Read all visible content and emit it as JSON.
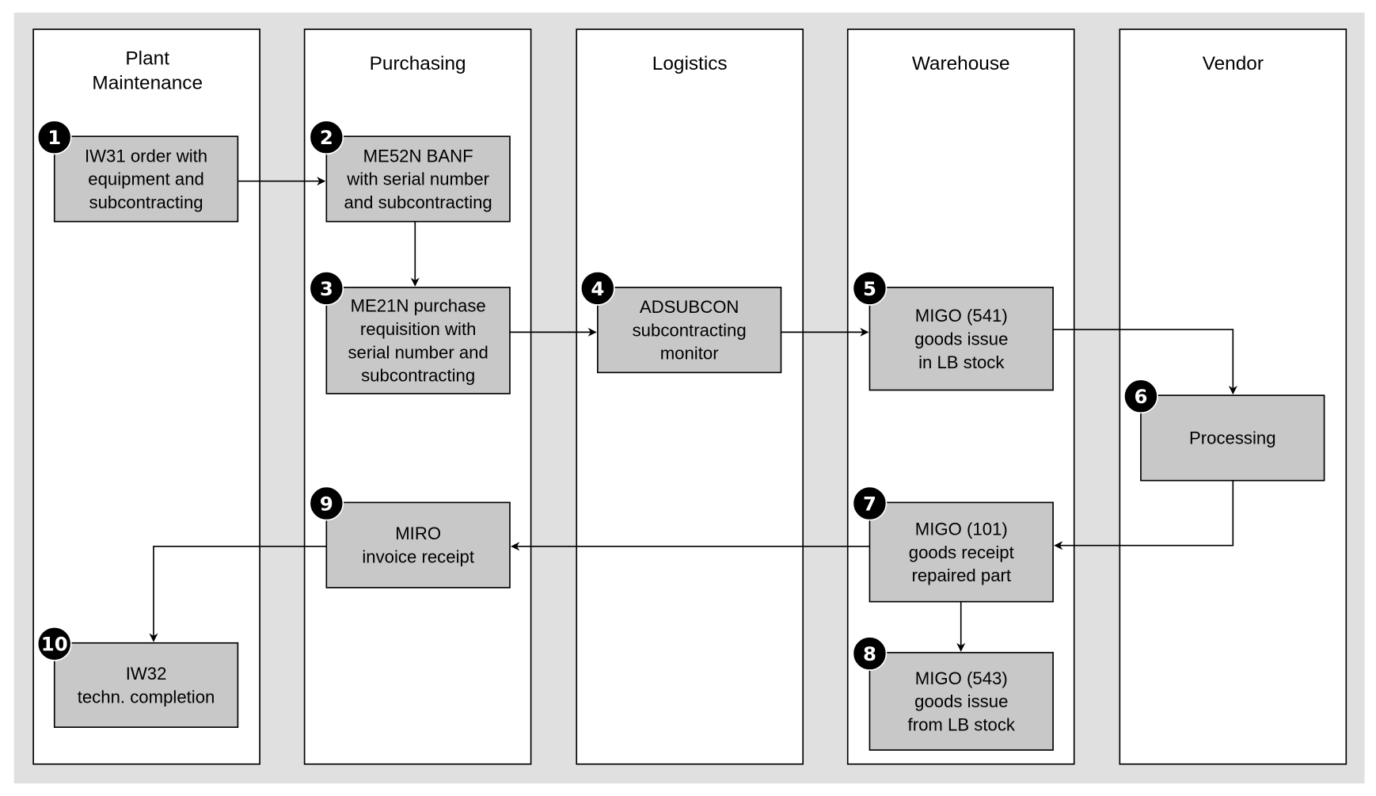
{
  "colors": {
    "background": "#e0e0e0",
    "lane": "#ffffff",
    "box": "#c8c8c8",
    "badge": "#000000"
  },
  "lanes": [
    {
      "title": [
        "Plant",
        "Maintenance"
      ]
    },
    {
      "title": [
        "Purchasing"
      ]
    },
    {
      "title": [
        "Logistics"
      ]
    },
    {
      "title": [
        "Warehouse"
      ]
    },
    {
      "title": [
        "Vendor"
      ]
    }
  ],
  "steps": [
    {
      "num": "1",
      "lines": [
        "IW31 order with",
        "equipment and",
        "subcontracting"
      ]
    },
    {
      "num": "2",
      "lines": [
        "ME52N BANF",
        "with serial number",
        "and subcontracting"
      ]
    },
    {
      "num": "3",
      "lines": [
        "ME21N purchase",
        "requisition with",
        "serial number and",
        "subcontracting"
      ]
    },
    {
      "num": "4",
      "lines": [
        "ADSUBCON",
        "subcontracting",
        "monitor"
      ]
    },
    {
      "num": "5",
      "lines": [
        "MIGO (541)",
        "goods issue",
        "in LB stock"
      ]
    },
    {
      "num": "6",
      "lines": [
        "Processing"
      ]
    },
    {
      "num": "7",
      "lines": [
        "MIGO (101)",
        "goods receipt",
        "repaired part"
      ]
    },
    {
      "num": "8",
      "lines": [
        "MIGO (543)",
        "goods issue",
        "from LB stock"
      ]
    },
    {
      "num": "9",
      "lines": [
        "MIRO",
        "invoice receipt"
      ]
    },
    {
      "num": "10",
      "lines": [
        "IW32",
        "techn. completion"
      ]
    }
  ],
  "flows": [
    [
      "1",
      "2"
    ],
    [
      "2",
      "3"
    ],
    [
      "3",
      "4"
    ],
    [
      "4",
      "5"
    ],
    [
      "5",
      "6"
    ],
    [
      "6",
      "7"
    ],
    [
      "7",
      "8"
    ],
    [
      "7",
      "9"
    ],
    [
      "9",
      "10"
    ]
  ]
}
